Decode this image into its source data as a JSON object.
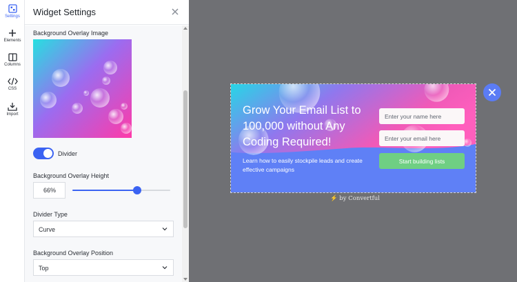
{
  "colors": {
    "accent": "#3b63f2",
    "canvas_bg": "#6f7074",
    "cta_green": "#6fcf83",
    "widget_blue": "#5f80f6",
    "close_circle": "#5b7cf5"
  },
  "rail": {
    "items": [
      {
        "label": "Settings",
        "icon": "settings-icon",
        "active": true
      },
      {
        "label": "Elements",
        "icon": "plus-icon"
      },
      {
        "label": "Columns",
        "icon": "columns-icon"
      },
      {
        "label": "CSS",
        "icon": "code-icon"
      },
      {
        "label": "Import",
        "icon": "import-icon"
      }
    ]
  },
  "panel": {
    "title": "Widget Settings",
    "close_icon": "close-icon",
    "overlay_image_label": "Background Overlay Image",
    "divider_toggle_label": "Divider",
    "divider_enabled": true,
    "overlay_height_label": "Background Overlay Height",
    "overlay_height_value": "66%",
    "overlay_height_slider_fraction": 0.66,
    "divider_type_label": "Divider Type",
    "divider_type_value": "Curve",
    "overlay_position_label": "Background Overlay Position",
    "overlay_position_value": "Top"
  },
  "preview": {
    "headline": "Grow Your Email List to 100,000 without Any Coding Required!",
    "subtext": "Learn how to easily stockpile leads and create effective campaigns",
    "name_placeholder": "Enter your name here",
    "email_placeholder": "Enter your email here",
    "cta_label": "Start building lists",
    "close_icon": "close-icon",
    "branding_prefix": "by",
    "branding_name": "Convertful",
    "branding_icon": "lightning-icon"
  }
}
